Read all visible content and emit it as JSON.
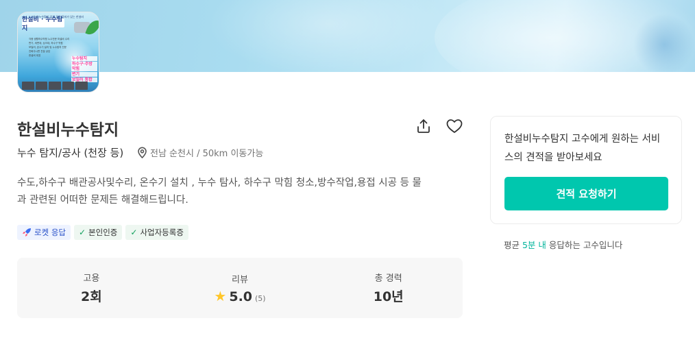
{
  "profile": {
    "image": {
      "top_text": "우리 누수탐지 업체 모든 장비가 있는 한설비",
      "title": "한설비 · 누수탐지",
      "body_lines": [
        "각종 생활하수막힘 누수전문 미설비 수리",
        "변기, 세면대, 싱크대, 하수구 막힘",
        "보일러, 온수기 설치 및 누수탐지 전문",
        "전화주시면 친절 상담",
        "한설비 대표"
      ],
      "highlight_lines": [
        "누수탐지",
        "하수구·주방 막힘",
        "변기",
        "보일러 통합"
      ]
    },
    "name": "한설비누수탐지",
    "category": "누수 탐지/공사 (천장 등)",
    "location": "전남 순천시 / 50km 이동가능",
    "description": "수도,하수구 배관공사및수리, 온수기 설치 , 누수 탐사, 하수구 막힘 청소,방수작업,용접 시공 등 물과 관련된 어떠한 문제든 해결해드립니다.",
    "badges": {
      "rocket": "로켓 응답",
      "identity": "본인인증",
      "business": "사업자등록증"
    },
    "icons": {
      "share": "share-icon",
      "like": "heart-icon",
      "location": "map-pin-icon",
      "rocket": "rocket-icon",
      "check": "check-icon",
      "star": "star-icon"
    }
  },
  "stats": {
    "hire": {
      "label": "고용",
      "value": "2회"
    },
    "review": {
      "label": "리뷰",
      "value": "5.0",
      "count": "(5)"
    },
    "career": {
      "label": "총 경력",
      "value": "10년"
    }
  },
  "quote": {
    "text": "한설비누수탐지 고수에게 원하는 서비스의 견적을 받아보세요",
    "button": "견적 요청하기"
  },
  "response": {
    "prefix": "평균 ",
    "highlight": "5분 내",
    "suffix": " 응답하는 고수입니다"
  },
  "colors": {
    "accent": "#00c7ae",
    "star": "#ffc629",
    "banner": "#a9dcf0"
  }
}
